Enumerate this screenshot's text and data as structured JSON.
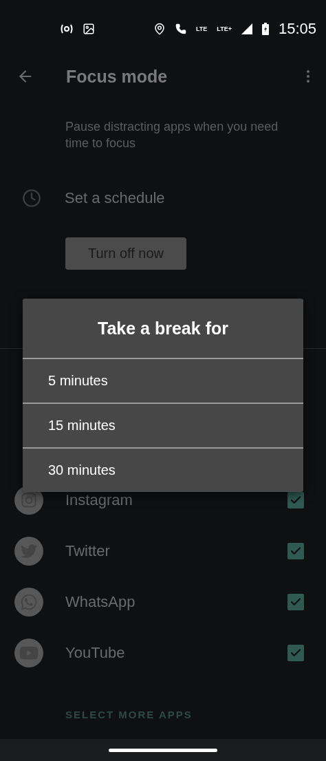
{
  "status_bar": {
    "time": "15:05",
    "network_labels": [
      "LTE",
      "LTE+"
    ]
  },
  "app_bar": {
    "title": "Focus mode"
  },
  "description": "Pause distracting apps when you need time to focus",
  "schedule": {
    "label": "Set a schedule"
  },
  "turn_off_button": "Turn off now",
  "apps": [
    {
      "name": "Instagram",
      "checked": true
    },
    {
      "name": "Twitter",
      "checked": true
    },
    {
      "name": "WhatsApp",
      "checked": true
    },
    {
      "name": "YouTube",
      "checked": true
    }
  ],
  "select_more": "SELECT MORE APPS",
  "dialog": {
    "title": "Take a break for",
    "options": [
      {
        "label": "5 minutes"
      },
      {
        "label": "15 minutes"
      },
      {
        "label": "30 minutes"
      }
    ]
  }
}
